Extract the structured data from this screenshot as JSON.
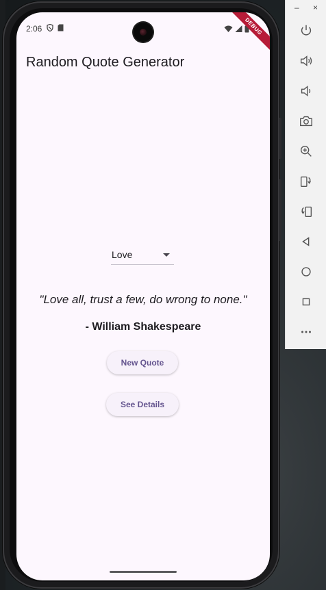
{
  "status_bar": {
    "time": "2:06"
  },
  "debug_banner": "DEBUG",
  "app": {
    "title": "Random Quote Generator",
    "category_dropdown": {
      "selected": "Love"
    },
    "quote": {
      "text": "\"Love all, trust a few, do wrong to none.\"",
      "author": "- William Shakespeare"
    },
    "buttons": {
      "new_quote": "New Quote",
      "see_details": "See Details"
    }
  },
  "emulator_toolbar": {
    "window_controls": {
      "minimize": "–",
      "close": "×"
    },
    "tools": [
      "power-icon",
      "volume-up-icon",
      "volume-down-icon",
      "camera-icon",
      "zoom-icon",
      "rotate-left-icon",
      "rotate-right-icon",
      "back-icon",
      "home-icon",
      "overview-icon",
      "more-icon"
    ]
  },
  "colors": {
    "screen_bg": "#fdf7fe",
    "button_text": "#65558f",
    "button_bg": "#f7f1fa",
    "debug_banner": "#b71c38"
  }
}
